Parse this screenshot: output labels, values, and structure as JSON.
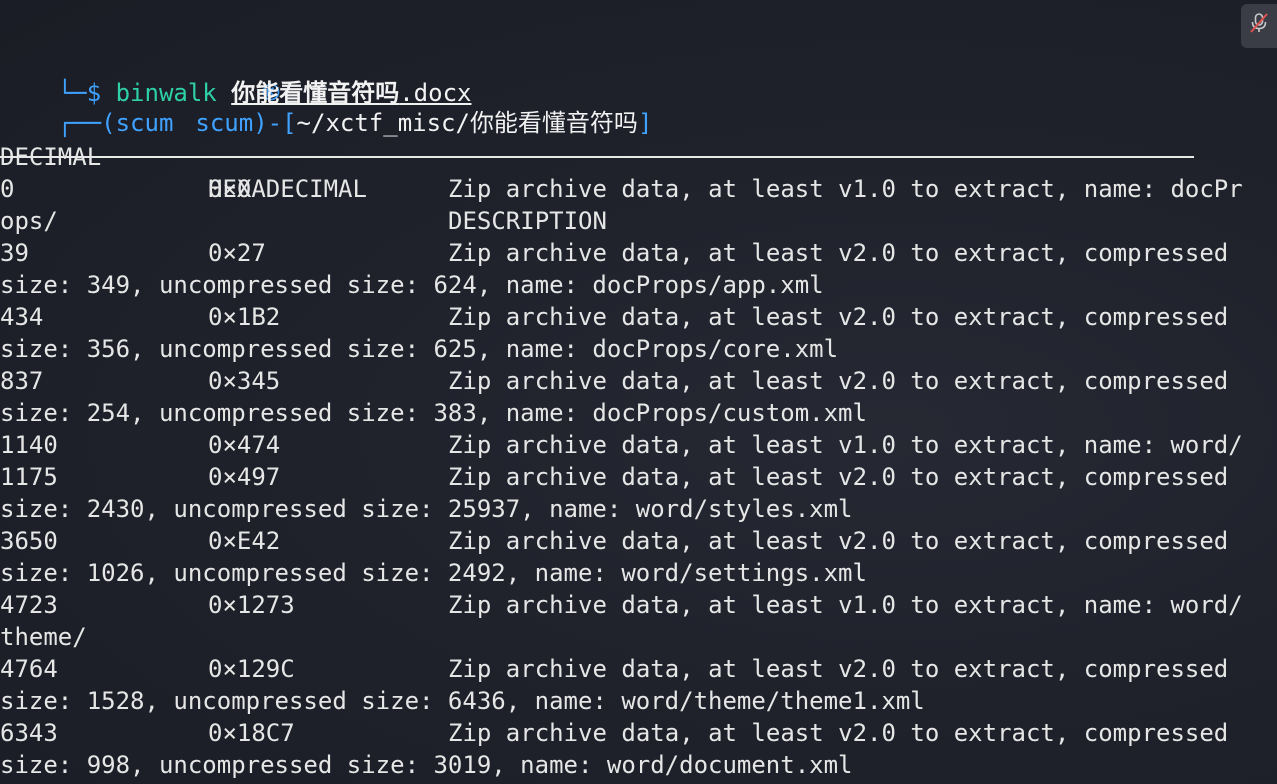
{
  "prompt": {
    "open": "┌──(",
    "user": "scum",
    "host_icon": "kali-dragon-icon",
    "host": "scum",
    "sep": ")-[",
    "path": "~/xctf_misc/你能看懂音符吗",
    "close": "]",
    "line2_prefix": "└─",
    "dollar": "$"
  },
  "command": {
    "program": "binwalk",
    "arg_bold": "你能看懂音符吗",
    "arg_rest": ".docx"
  },
  "table": {
    "headers": [
      "DECIMAL",
      "HEXADECIMAL",
      "DESCRIPTION"
    ],
    "rows": [
      {
        "decimal": "0",
        "hex": "0×0",
        "desc": "Zip archive data, at least v1.0 to extract, name: docPr",
        "cont": "ops/"
      },
      {
        "decimal": "39",
        "hex": "0×27",
        "desc": "Zip archive data, at least v2.0 to extract, compressed",
        "cont": "size: 349, uncompressed size: 624, name: docProps/app.xml"
      },
      {
        "decimal": "434",
        "hex": "0×1B2",
        "desc": "Zip archive data, at least v2.0 to extract, compressed",
        "cont": "size: 356, uncompressed size: 625, name: docProps/core.xml"
      },
      {
        "decimal": "837",
        "hex": "0×345",
        "desc": "Zip archive data, at least v2.0 to extract, compressed",
        "cont": "size: 254, uncompressed size: 383, name: docProps/custom.xml"
      },
      {
        "decimal": "1140",
        "hex": "0×474",
        "desc": "Zip archive data, at least v1.0 to extract, name: word/",
        "cont": ""
      },
      {
        "decimal": "1175",
        "hex": "0×497",
        "desc": "Zip archive data, at least v2.0 to extract, compressed",
        "cont": "size: 2430, uncompressed size: 25937, name: word/styles.xml"
      },
      {
        "decimal": "3650",
        "hex": "0×E42",
        "desc": "Zip archive data, at least v2.0 to extract, compressed",
        "cont": "size: 1026, uncompressed size: 2492, name: word/settings.xml"
      },
      {
        "decimal": "4723",
        "hex": "0×1273",
        "desc": "Zip archive data, at least v1.0 to extract, name: word/",
        "cont": "theme/"
      },
      {
        "decimal": "4764",
        "hex": "0×129C",
        "desc": "Zip archive data, at least v2.0 to extract, compressed",
        "cont": "size: 1528, uncompressed size: 6436, name: word/theme/theme1.xml"
      },
      {
        "decimal": "6343",
        "hex": "0×18C7",
        "desc": "Zip archive data, at least v2.0 to extract, compressed",
        "cont": "size: 998, uncompressed size: 3019, name: word/document.xml"
      }
    ]
  },
  "overlay": {
    "icon": "microphone-muted-icon"
  },
  "colors": {
    "background": "#1d1f29",
    "prompt_blue": "#3fa2ff",
    "command_green": "#2ed0a8",
    "text": "#e6e6e6",
    "mute_icon_red": "#e0524f"
  }
}
